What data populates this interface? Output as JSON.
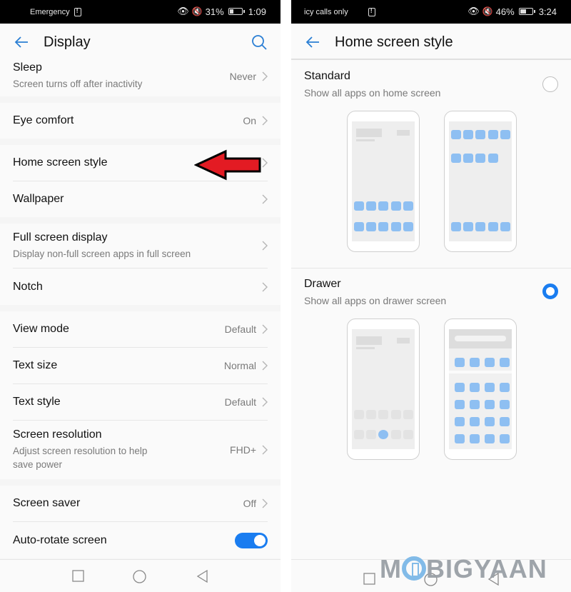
{
  "left": {
    "statusbar": {
      "left_text": "Emergency",
      "battery": "31%",
      "time": "1:09",
      "icons": [
        "eye-comfort-icon",
        "mute-icon",
        "sim-alert-icon",
        "battery-icon"
      ]
    },
    "appbar": {
      "title": "Display",
      "back_icon": "back-arrow-icon",
      "search_icon": "search-icon"
    },
    "groups": [
      [
        {
          "label": "Sleep",
          "sub": "Screen turns off after inactivity",
          "value": "Never",
          "chevron": true
        }
      ],
      [
        {
          "label": "Eye comfort",
          "value": "On",
          "chevron": true
        }
      ],
      [
        {
          "label": "Home screen style",
          "value": "",
          "chevron": true,
          "highlighted_by_arrow": true
        },
        {
          "label": "Wallpaper",
          "value": "",
          "chevron": true
        }
      ],
      [
        {
          "label": "Full screen display",
          "sub": "Display non-full screen apps in full screen",
          "value": "",
          "chevron": true
        },
        {
          "label": "Notch",
          "value": "",
          "chevron": true
        }
      ],
      [
        {
          "label": "View mode",
          "value": "Default",
          "chevron": true
        },
        {
          "label": "Text size",
          "value": "Normal",
          "chevron": true
        },
        {
          "label": "Text style",
          "value": "Default",
          "chevron": true
        },
        {
          "label": "Screen resolution",
          "sub": "Adjust screen resolution to help save power",
          "value": "FHD+",
          "chevron": true
        }
      ],
      [
        {
          "label": "Screen saver",
          "value": "Off",
          "chevron": true
        },
        {
          "label": "Auto-rotate screen",
          "toggle": true,
          "toggle_on": true
        }
      ]
    ],
    "annotation": {
      "type": "red-arrow",
      "color": "#e31b23",
      "points_to": "Home screen style"
    }
  },
  "right": {
    "statusbar": {
      "left_text": "icy calls only",
      "battery": "46%",
      "time": "3:24",
      "charging": true
    },
    "appbar": {
      "title": "Home screen style",
      "back_icon": "back-arrow-icon"
    },
    "options": [
      {
        "label": "Standard",
        "sub": "Show all apps on home screen",
        "selected": false
      },
      {
        "label": "Drawer",
        "sub": "Show all apps on drawer screen",
        "selected": true
      }
    ]
  },
  "navbar": {
    "buttons": [
      "recents-square-icon",
      "home-circle-icon",
      "back-triangle-icon"
    ]
  },
  "watermark": {
    "text_left": "M",
    "text_right": "BIGYAAN"
  },
  "colors": {
    "accent": "#1a7df0",
    "app_tile": "#8ebff2",
    "annotation_red": "#e31b23"
  }
}
